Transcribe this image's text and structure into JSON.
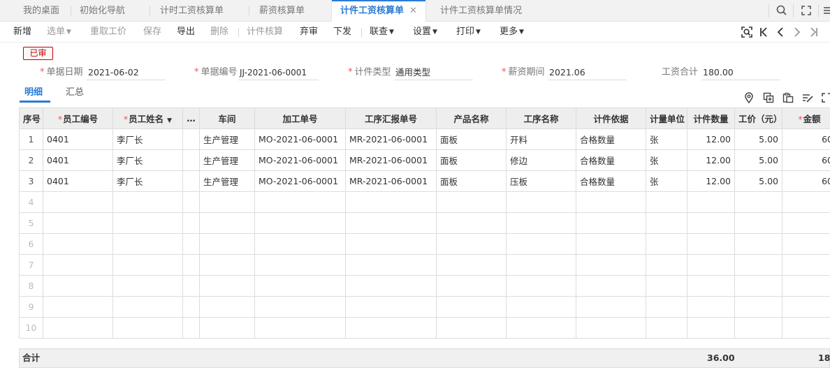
{
  "tabs": [
    {
      "label": "我的桌面"
    },
    {
      "label": "初始化导航"
    },
    {
      "label": "计时工资核算单"
    },
    {
      "label": "薪资核算单"
    },
    {
      "label": "计件工资核算单",
      "close": "✕"
    },
    {
      "label": "计件工资核算单情况"
    }
  ],
  "toolbar": {
    "add": "新增",
    "select_bill": "选单",
    "refetch_wage": "重取工价",
    "save": "保存",
    "export": "导出",
    "delete": "删除",
    "piece_calc": "计件核算",
    "unaudit": "弃审",
    "issue": "下发",
    "linked_query": "联查",
    "settings": "设置",
    "print": "打印",
    "more": "更多"
  },
  "status_badge": "已审",
  "form": {
    "date_label": "单据日期",
    "date_value": "2021-06-02",
    "number_label": "单据编号",
    "number_value": "JJ-2021-06-0001",
    "type_label": "计件类型",
    "type_value": "通用类型",
    "period_label": "薪资期间",
    "period_value": "2021.06",
    "total_label": "工资合计",
    "total_value": "180.00"
  },
  "subtabs": {
    "detail": "明细",
    "summary": "汇总"
  },
  "grid": {
    "headers": {
      "index": "序号",
      "emp_code": "员工编号",
      "emp_name": "员工姓名",
      "more": "…",
      "workshop": "车间",
      "work_order": "加工单号",
      "process_report": "工序汇报单号",
      "product": "产品名称",
      "process": "工序名称",
      "basis": "计件依据",
      "unit": "计量单位",
      "qty": "计件数量",
      "price": "工价（元）",
      "amount": "金额"
    },
    "rows": [
      {
        "idx": "1",
        "emp_code": "0401",
        "emp_name": "李厂长",
        "workshop": "生产管理",
        "work_order": "MO-2021-06-0001",
        "process_report": "MR-2021-06-0001",
        "product": "面板",
        "process": "开料",
        "basis": "合格数量",
        "unit": "张",
        "qty": "12.00",
        "price": "5.00",
        "amount": "60"
      },
      {
        "idx": "2",
        "emp_code": "0401",
        "emp_name": "李厂长",
        "workshop": "生产管理",
        "work_order": "MO-2021-06-0001",
        "process_report": "MR-2021-06-0001",
        "product": "面板",
        "process": "修边",
        "basis": "合格数量",
        "unit": "张",
        "qty": "12.00",
        "price": "5.00",
        "amount": "60"
      },
      {
        "idx": "3",
        "emp_code": "0401",
        "emp_name": "李厂长",
        "workshop": "生产管理",
        "work_order": "MO-2021-06-0001",
        "process_report": "MR-2021-06-0001",
        "product": "面板",
        "process": "压板",
        "basis": "合格数量",
        "unit": "张",
        "qty": "12.00",
        "price": "5.00",
        "amount": "60"
      }
    ],
    "empty_rows": [
      "4",
      "5",
      "6",
      "7",
      "8",
      "9",
      "10"
    ]
  },
  "footer": {
    "label": "合计",
    "qty_total": "36.00",
    "amount_total": "18"
  }
}
